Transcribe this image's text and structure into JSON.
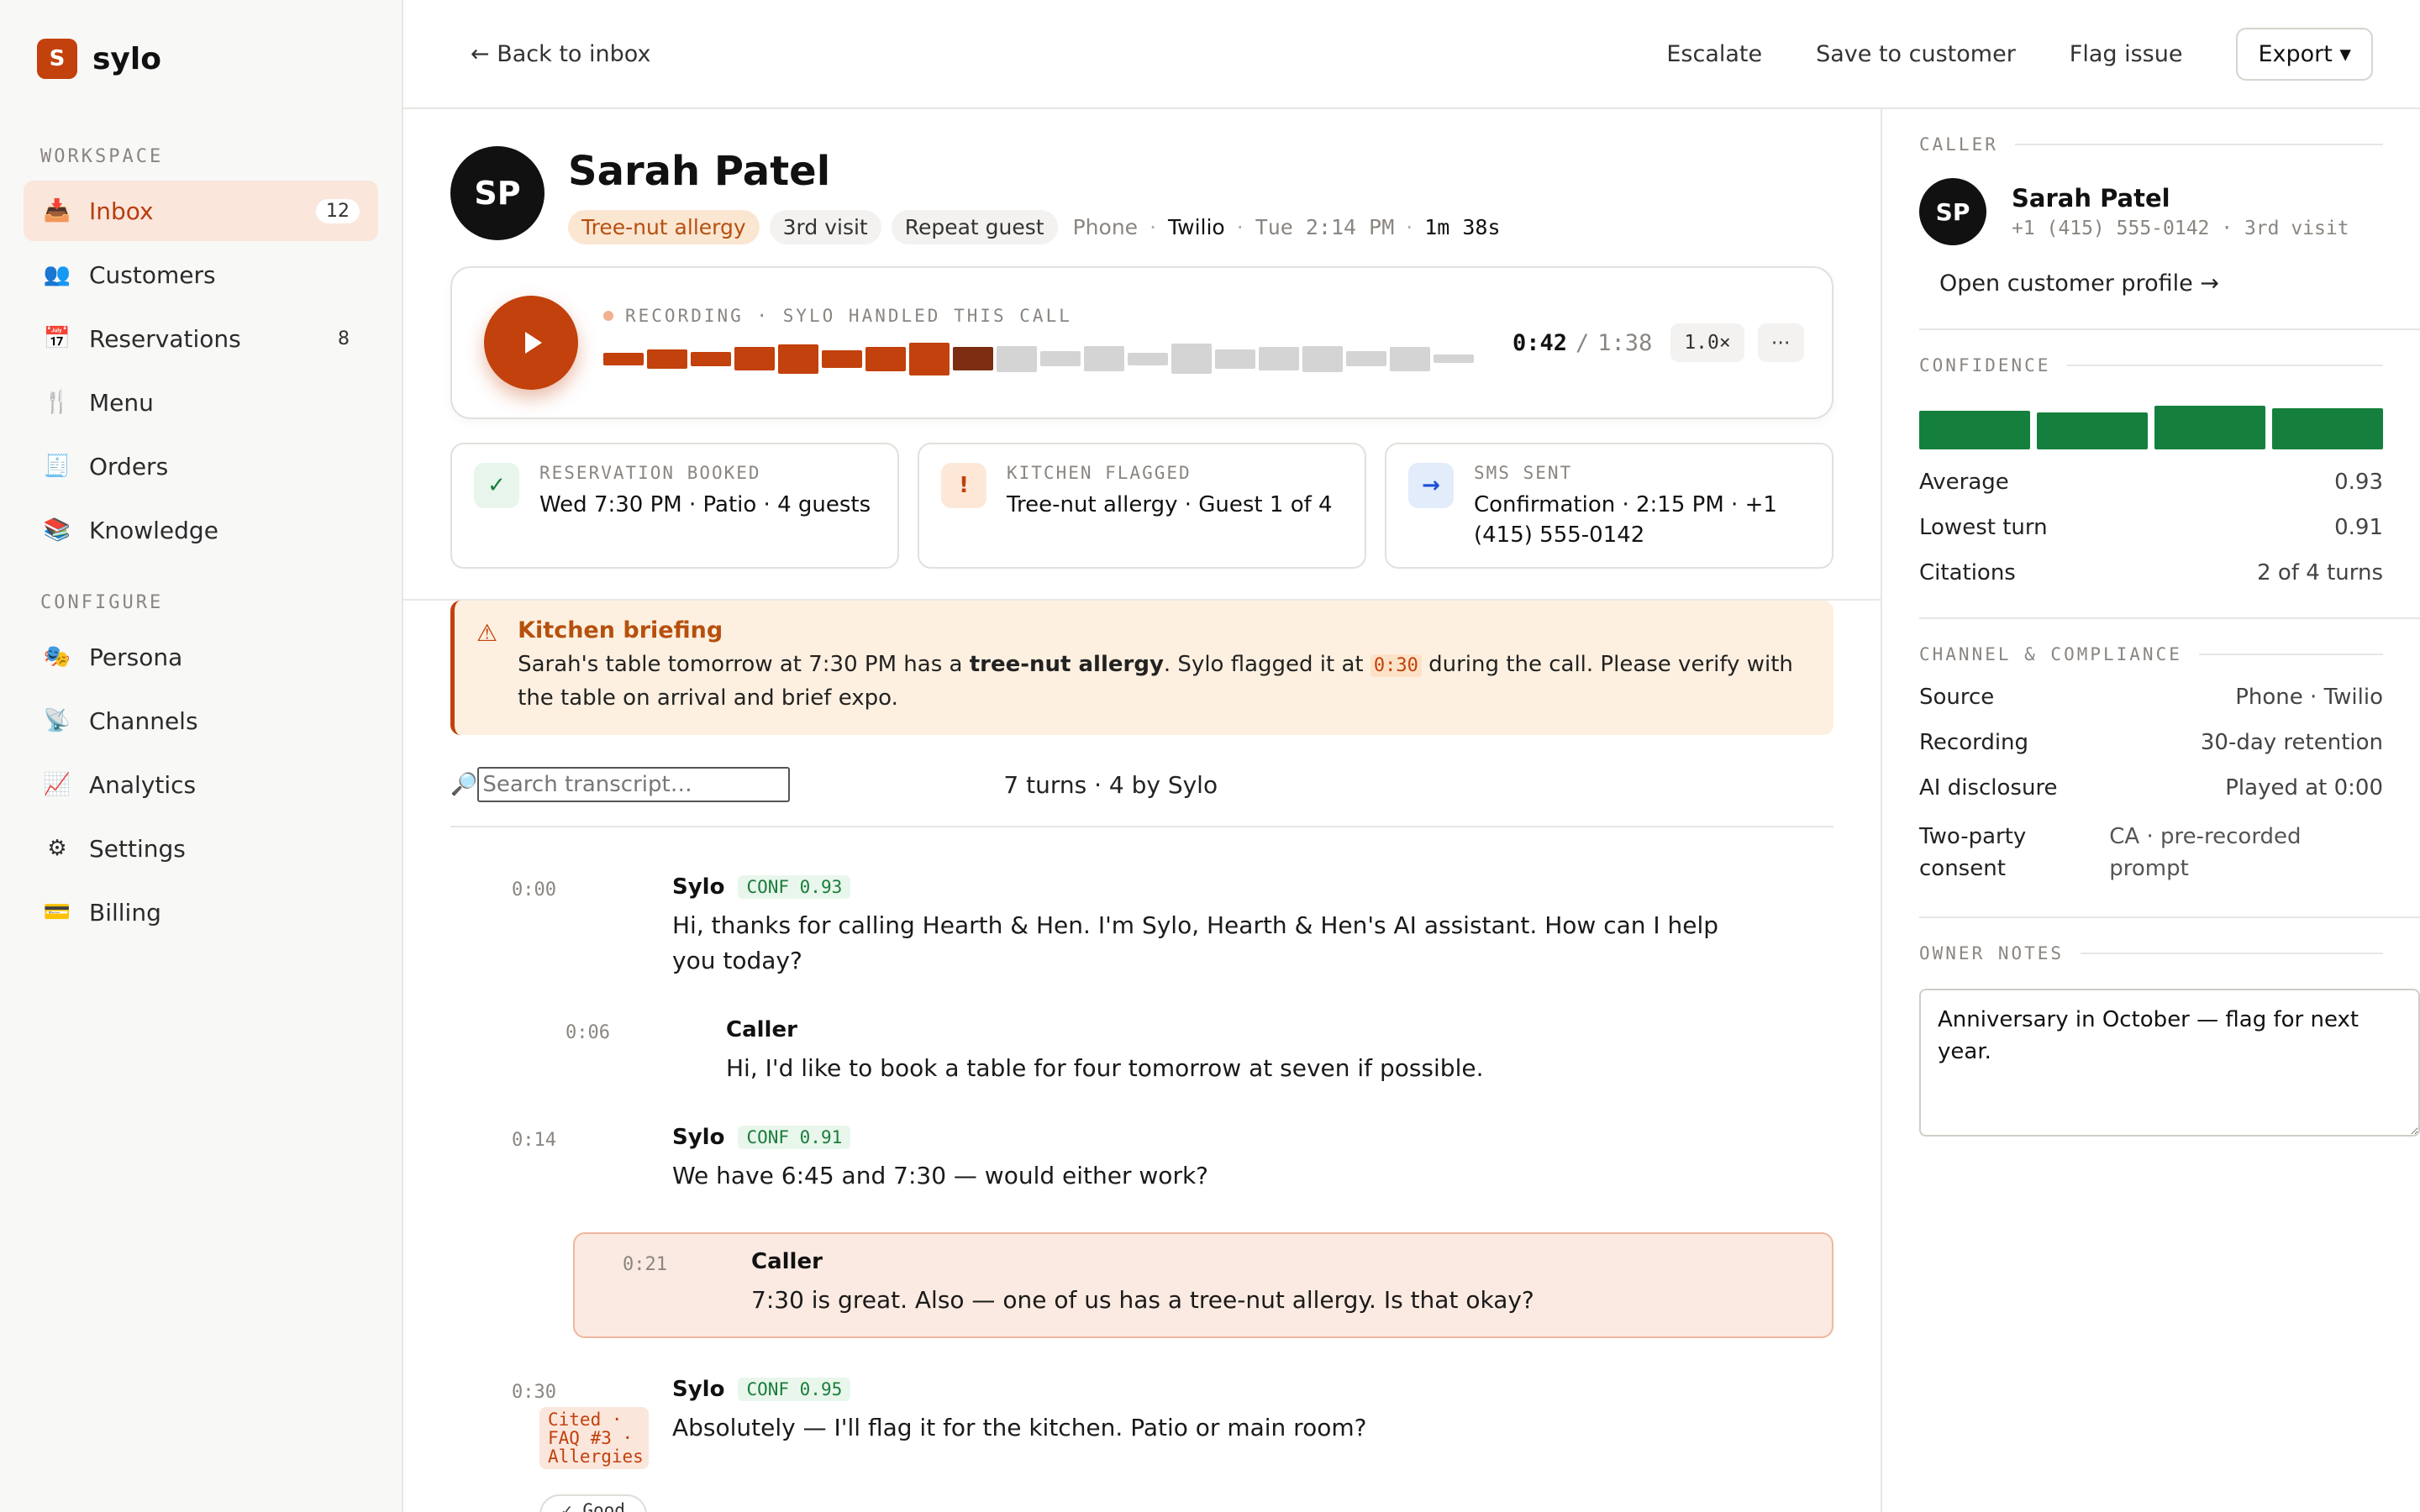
{
  "brand": {
    "logo_letter": "S",
    "name": "sylo",
    "color": "#c2410c"
  },
  "sidebar": {
    "workspace_label": "WORKSPACE",
    "configure_label": "CONFIGURE",
    "workspace_items": [
      {
        "icon": "📥",
        "icon_name": "inbox-icon",
        "label": "Inbox",
        "count": "12",
        "active": true
      },
      {
        "icon": "👥",
        "icon_name": "customers-icon",
        "label": "Customers",
        "count": ""
      },
      {
        "icon": "📅",
        "icon_name": "calendar-icon",
        "label": "Reservations",
        "count": "8"
      },
      {
        "icon": "🍴",
        "icon_name": "fork-knife-icon",
        "label": "Menu",
        "count": ""
      },
      {
        "icon": "🧾",
        "icon_name": "receipt-icon",
        "label": "Orders",
        "count": ""
      },
      {
        "icon": "📚",
        "icon_name": "books-icon",
        "label": "Knowledge",
        "count": ""
      }
    ],
    "configure_items": [
      {
        "icon": "🎭",
        "icon_name": "masks-icon",
        "label": "Persona"
      },
      {
        "icon": "📡",
        "icon_name": "antenna-icon",
        "label": "Channels"
      },
      {
        "icon": "📈",
        "icon_name": "chart-icon",
        "label": "Analytics"
      },
      {
        "icon": "⚙",
        "icon_name": "gear-icon",
        "label": "Settings"
      },
      {
        "icon": "💳",
        "icon_name": "credit-card-icon",
        "label": "Billing"
      }
    ]
  },
  "topbar": {
    "back": "← Back to inbox",
    "escalate": "Escalate",
    "save": "Save to customer",
    "flag": "Flag issue",
    "export": "Export ▾"
  },
  "caller": {
    "initials": "SP",
    "name": "Sarah Patel",
    "tag_allergy": "Tree-nut allergy",
    "tag_visit": "3rd visit",
    "tag_repeat": "Repeat guest",
    "channel": "Phone",
    "provider": "Twilio",
    "time": "Tue 2:14 PM",
    "duration": "1m 38s"
  },
  "player": {
    "label": "RECORDING · SYLO HANDLED THIS CALL",
    "current": "0:42",
    "sep": "/",
    "total": "1:38",
    "speed": "1.0×",
    "more": "⋯",
    "progress": 0.43,
    "wave_levels": [
      0.3,
      0.45,
      0.33,
      0.55,
      0.7,
      0.42,
      0.58,
      0.78,
      0.55,
      0.62,
      0.35,
      0.6,
      0.3,
      0.72,
      0.45,
      0.55,
      0.62,
      0.35,
      0.58,
      0.2
    ],
    "played_color": "#c2410c",
    "current_color": "#7c2d12",
    "unplayed_color": "#d4d4d4"
  },
  "events": [
    {
      "icon": "✓",
      "icon_name": "check-icon",
      "label": "RESERVATION BOOKED",
      "value": "Wed 7:30 PM · Patio · 4 guests",
      "fg": "#15803d",
      "bg": "#e8f5ec"
    },
    {
      "icon": "!",
      "icon_name": "alert-icon",
      "label": "KITCHEN FLAGGED",
      "value": "Tree-nut allergy · Guest 1 of 4",
      "fg": "#c2410c",
      "bg": "#fde8d8"
    },
    {
      "icon": "→",
      "icon_name": "arrow-right-icon",
      "label": "SMS SENT",
      "value": "Confirmation · 2:15 PM · +1 (415) 555-0142",
      "fg": "#1d4ed8",
      "bg": "#e3ecfb"
    }
  ],
  "briefing": {
    "icon": "⚠",
    "title": "Kitchen briefing",
    "text_1": "Sarah's table tomorrow at 7:30 PM has a ",
    "bold": "tree-nut allergy",
    "text_2": ". Sylo flagged it at ",
    "time": "0:30",
    "text_3": " during the call. Please verify with the table on arrival and brief expo."
  },
  "search": {
    "placeholder": "Search transcript…",
    "icon": "🔎",
    "turn_summary": "7 turns · 4 by Sylo"
  },
  "transcript": [
    {
      "time": "0:00",
      "speaker": "Sylo",
      "conf": "CONF 0.93",
      "text": "Hi, thanks for calling Hearth & Hen. I'm Sylo, Hearth & Hen's AI assistant. How can I help you today?"
    },
    {
      "time": "0:06",
      "speaker": "Caller",
      "text": "Hi, I'd like to book a table for four tomorrow at seven if possible."
    },
    {
      "time": "0:14",
      "speaker": "Sylo",
      "conf": "CONF 0.91",
      "text": "We have 6:45 and 7:30 — would either work?"
    },
    {
      "time": "0:21",
      "speaker": "Caller",
      "text": "7:30 is great. Also — one of us has a tree-nut allergy. Is that okay?"
    },
    {
      "time": "0:30",
      "speaker": "Sylo",
      "conf": "CONF 0.95",
      "text": "Absolutely — I'll flag it for the kitchen. Patio or main room?",
      "cite": "Cited · FAQ #3 · Allergies",
      "good": "✓ Good example"
    }
  ],
  "right": {
    "caller_title": "CALLER",
    "caller_initials": "SP",
    "caller_name": "Sarah Patel",
    "caller_sub": "+1 (415) 555-0142 · 3rd visit",
    "profile_link": "Open customer profile →",
    "confidence_title": "CONFIDENCE",
    "confidence_bars": [
      0.93,
      0.91,
      0.98,
      0.95
    ],
    "confidence_color": "#15803d",
    "average_label": "Average",
    "average_value": "0.93",
    "lowest_label": "Lowest turn",
    "lowest_value": "0.91",
    "citations_label": "Citations",
    "citations_value": "2 of 4 turns",
    "channel_title": "CHANNEL & COMPLIANCE",
    "source_label": "Source",
    "source_value": "Phone · Twilio",
    "recording_label": "Recording",
    "recording_value": "30-day retention",
    "disclosure_label": "AI disclosure",
    "disclosure_value": "Played at 0:00",
    "consent_label": "Two-party consent",
    "consent_value": "CA · pre-recorded prompt",
    "notes_title": "OWNER NOTES",
    "notes_value": "Anniversary in October — flag for next year."
  }
}
